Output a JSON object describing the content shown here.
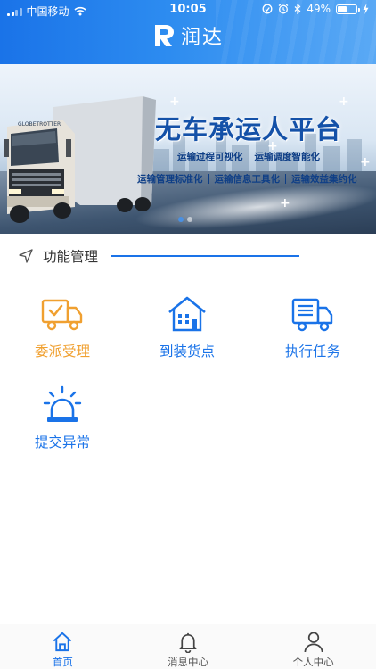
{
  "status_bar": {
    "carrier": "中国移动",
    "time": "10:05",
    "battery_text": "49%",
    "battery_level": 0.49
  },
  "nav": {
    "brand_name": "润达"
  },
  "banner": {
    "title": "无车承运人平台",
    "tags_row1": [
      "运输过程可视化",
      "运输调度智能化"
    ],
    "tags_row2": [
      "运输管理标准化",
      "运输信息工具化",
      "运输效益集约化"
    ],
    "page_count": 2,
    "active_page": 1
  },
  "section": {
    "title": "功能管理"
  },
  "functions": [
    {
      "label": "委派受理",
      "icon": "truck-check-icon",
      "color": "#f0a030"
    },
    {
      "label": "到装货点",
      "icon": "building-icon",
      "color": "#1a73e8"
    },
    {
      "label": "执行任务",
      "icon": "delivery-truck-icon",
      "color": "#1a73e8"
    },
    {
      "label": "提交异常",
      "icon": "alarm-light-icon",
      "color": "#1a73e8"
    }
  ],
  "tabbar": {
    "tabs": [
      {
        "label": "首页",
        "icon": "home-icon",
        "active": true
      },
      {
        "label": "消息中心",
        "icon": "bell-icon",
        "active": false
      },
      {
        "label": "个人中心",
        "icon": "user-icon",
        "active": false
      }
    ]
  },
  "colors": {
    "primary": "#1a73e8",
    "accent_orange": "#f0a030"
  }
}
